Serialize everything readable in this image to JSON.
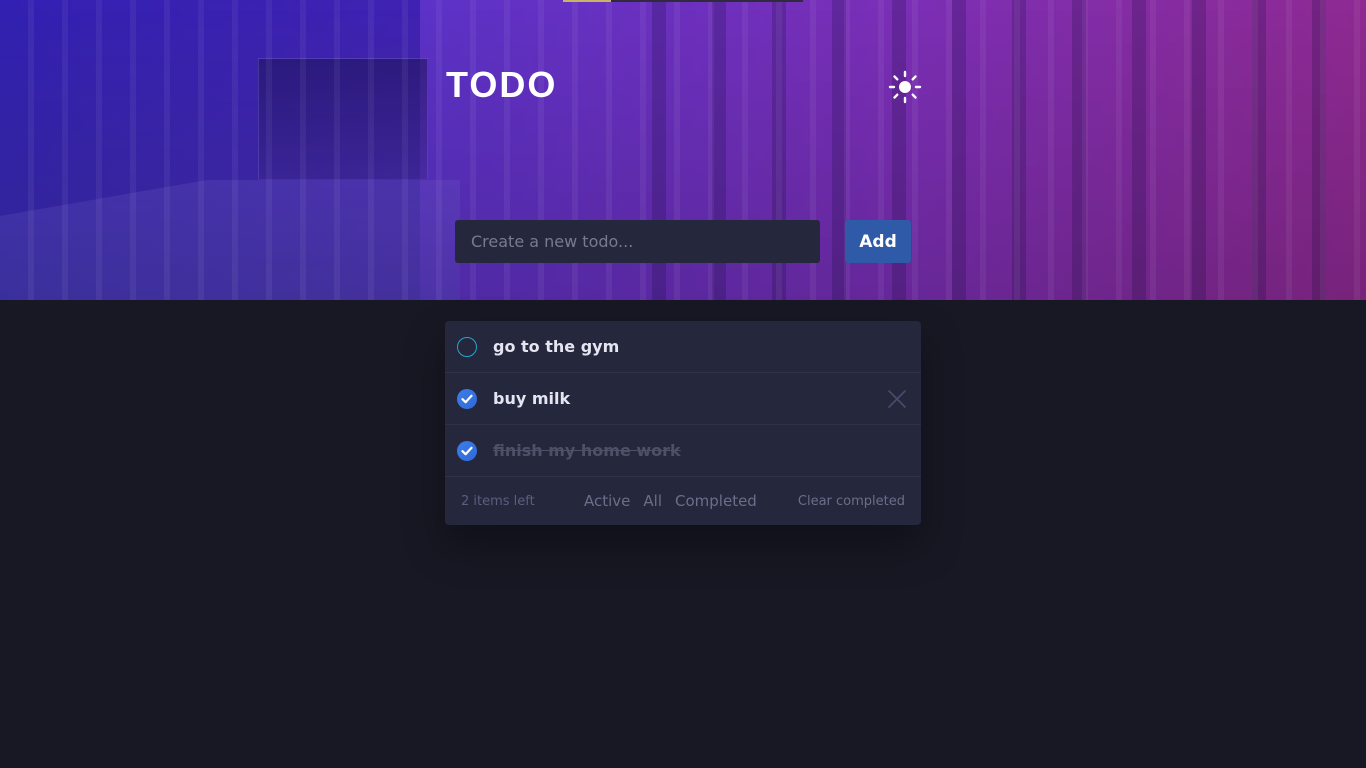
{
  "app": {
    "title": "TODO"
  },
  "header": {
    "theme_toggle_icon": "sun-icon"
  },
  "input": {
    "placeholder": "Create a new todo...",
    "value": ""
  },
  "actions": {
    "add_label": "Add"
  },
  "todos": [
    {
      "text": "go to the gym",
      "completed": false,
      "show_delete": false
    },
    {
      "text": "buy milk",
      "completed": true,
      "show_delete": true
    },
    {
      "text": "finish my home work",
      "completed": true,
      "show_delete": false
    }
  ],
  "footer": {
    "items_left": "2 items left",
    "filters": [
      "Active",
      "All",
      "Completed"
    ],
    "clear_label": "Clear completed"
  },
  "colors": {
    "background": "#181824",
    "panel": "#25273d",
    "accent": "#2f5aa8",
    "check_unchecked": "#21a7c9",
    "check_checked": "#3e7de6"
  }
}
